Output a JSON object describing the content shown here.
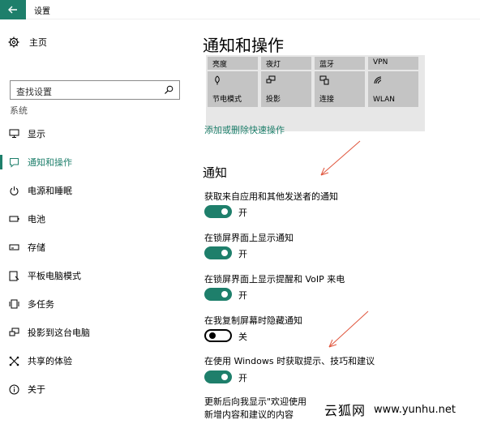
{
  "window": {
    "title": "设置"
  },
  "sidebar": {
    "home_label": "主页",
    "search_placeholder": "查找设置",
    "section_label": "系统",
    "items": [
      {
        "label": "显示",
        "icon": "monitor-icon"
      },
      {
        "label": "通知和操作",
        "icon": "notification-icon",
        "active": true
      },
      {
        "label": "电源和睡眠",
        "icon": "power-icon"
      },
      {
        "label": "电池",
        "icon": "battery-icon"
      },
      {
        "label": "存储",
        "icon": "storage-icon"
      },
      {
        "label": "平板电脑模式",
        "icon": "tablet-icon"
      },
      {
        "label": "多任务",
        "icon": "multitask-icon"
      },
      {
        "label": "投影到这台电脑",
        "icon": "project-icon"
      },
      {
        "label": "共享的体验",
        "icon": "share-icon"
      },
      {
        "label": "关于",
        "icon": "info-icon"
      }
    ]
  },
  "main": {
    "title": "通知和操作",
    "quick_actions": {
      "row1": [
        "亮度",
        "夜灯",
        "蓝牙",
        "VPN"
      ],
      "row2": [
        "节电模式",
        "投影",
        "连接",
        "WLAN"
      ]
    },
    "add_remove_link": "添加或删除快速操作",
    "section_title": "通知",
    "settings": [
      {
        "label": "获取来自应用和其他发送者的通知",
        "on": true,
        "state_label": "开"
      },
      {
        "label": "在锁屏界面上显示通知",
        "on": true,
        "state_label": "开"
      },
      {
        "label": "在锁屏界面上显示提醒和 VoIP 来电",
        "on": true,
        "state_label": "开"
      },
      {
        "label": "在我复制屏幕时隐藏通知",
        "on": false,
        "state_label": "关"
      },
      {
        "label": "在使用 Windows 时获取提示、技巧和建议",
        "on": true,
        "state_label": "开"
      }
    ],
    "bottom_text_line1": "更新后向我显示\"欢迎使用 ",
    "bottom_text_line2": "新增内容和建议的内容"
  },
  "watermark": {
    "logo": "云狐网",
    "url": "www.yunhu.net"
  },
  "colors": {
    "accent": "#1e7f6b",
    "tile": "#c4c4c4",
    "annotation": "#e0553c"
  }
}
